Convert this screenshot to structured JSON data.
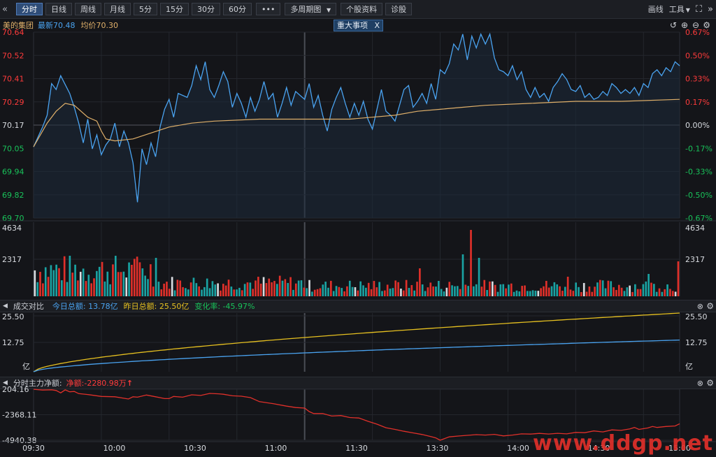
{
  "toolbar": {
    "collapse_icon": "double-chevron-left-icon",
    "tabs": [
      "分时",
      "日线",
      "周线",
      "月线",
      "5分",
      "15分",
      "30分",
      "60分"
    ],
    "more_label": "•••",
    "multi_period_label": "多周期图",
    "stock_info_label": "个股资料",
    "diagnose_label": "诊股",
    "draw_label": "画线",
    "tools_label": "工具",
    "expand_icon": "fullscreen-icon",
    "forward_icon": "double-chevron-right-icon"
  },
  "info": {
    "stock_name": "美的集团",
    "latest": "最新70.48",
    "avg": "均价70.30",
    "event_tag": "重大事项",
    "event_close": "X"
  },
  "colors": {
    "up": "#ff3b3b",
    "down": "#19c25a",
    "price_line": "#4aa3f0",
    "avg_line": "#e0b06a",
    "today_amount": "#4aa3f0",
    "yesterday_amount": "#e6c020"
  },
  "price_axis": {
    "left": [
      "70.64",
      "70.52",
      "70.41",
      "70.29",
      "70.17",
      "70.05",
      "69.94",
      "69.82",
      "69.70"
    ],
    "right": [
      "0.67%",
      "0.50%",
      "0.33%",
      "0.17%",
      "0.00%",
      "-0.17%",
      "-0.33%",
      "-0.50%",
      "-0.67%"
    ]
  },
  "volume_axis": {
    "top": "4634",
    "mid": "2317"
  },
  "turnover_panel": {
    "title": "成交对比",
    "today": "今日总额: 13.78亿",
    "yesterday": "昨日总额: 25.50亿",
    "change": "变化率: -45.97%",
    "axis": [
      "25.50",
      "12.75",
      "亿"
    ]
  },
  "netflow_panel": {
    "title": "分时主力净额:",
    "net": "净额:-2280.98万",
    "up_arrow": "↑",
    "axis": [
      "204.16",
      "-2368.11",
      "-4940.38"
    ]
  },
  "time_axis": [
    "09:30",
    "10:00",
    "10:30",
    "11:00",
    "11:30",
    "13:30",
    "14:00",
    "14:30",
    "15:00"
  ],
  "watermark": "www.ddgp.net",
  "chart_data": {
    "type": "line",
    "price_range": [
      69.7,
      70.64
    ],
    "prev_close": 70.17,
    "price_points": [
      [
        0,
        70.06
      ],
      [
        2,
        70.16
      ],
      [
        3,
        70.22
      ],
      [
        4,
        70.38
      ],
      [
        5,
        70.35
      ],
      [
        6,
        70.42
      ],
      [
        8,
        70.33
      ],
      [
        9,
        70.26
      ],
      [
        10,
        70.18
      ],
      [
        11,
        70.08
      ],
      [
        12,
        70.2
      ],
      [
        13,
        70.05
      ],
      [
        14,
        70.12
      ],
      [
        15,
        70.02
      ],
      [
        16,
        70.07
      ],
      [
        17,
        70.1
      ],
      [
        18,
        70.18
      ],
      [
        19,
        70.06
      ],
      [
        20,
        70.14
      ],
      [
        21,
        70.08
      ],
      [
        22,
        69.98
      ],
      [
        23,
        69.78
      ],
      [
        24,
        70.05
      ],
      [
        25,
        69.97
      ],
      [
        26,
        70.08
      ],
      [
        27,
        70.01
      ],
      [
        28,
        70.16
      ],
      [
        29,
        70.25
      ],
      [
        30,
        70.3
      ],
      [
        31,
        70.21
      ],
      [
        32,
        70.33
      ],
      [
        34,
        70.31
      ],
      [
        35,
        70.37
      ],
      [
        36,
        70.47
      ],
      [
        37,
        70.4
      ],
      [
        38,
        70.49
      ],
      [
        39,
        70.35
      ],
      [
        40,
        70.31
      ],
      [
        41,
        70.37
      ],
      [
        42,
        70.44
      ],
      [
        43,
        70.39
      ],
      [
        44,
        70.26
      ],
      [
        45,
        70.33
      ],
      [
        46,
        70.28
      ],
      [
        47,
        70.21
      ],
      [
        48,
        70.31
      ],
      [
        49,
        70.24
      ],
      [
        50,
        70.3
      ],
      [
        51,
        70.39
      ],
      [
        52,
        70.3
      ],
      [
        53,
        70.33
      ],
      [
        54,
        70.21
      ],
      [
        55,
        70.28
      ],
      [
        56,
        70.36
      ],
      [
        57,
        70.27
      ],
      [
        58,
        70.34
      ],
      [
        60,
        70.3
      ],
      [
        61,
        70.38
      ],
      [
        62,
        70.26
      ],
      [
        63,
        70.32
      ],
      [
        64,
        70.22
      ],
      [
        65,
        70.14
      ],
      [
        66,
        70.25
      ],
      [
        67,
        70.31
      ],
      [
        68,
        70.36
      ],
      [
        69,
        70.28
      ],
      [
        70,
        70.21
      ],
      [
        71,
        70.28
      ],
      [
        72,
        70.22
      ],
      [
        73,
        70.29
      ],
      [
        74,
        70.2
      ],
      [
        75,
        70.15
      ],
      [
        76,
        70.25
      ],
      [
        77,
        70.35
      ],
      [
        78,
        70.24
      ],
      [
        79,
        70.22
      ],
      [
        80,
        70.19
      ],
      [
        81,
        70.27
      ],
      [
        82,
        70.35
      ],
      [
        83,
        70.37
      ],
      [
        84,
        70.26
      ],
      [
        85,
        70.29
      ],
      [
        86,
        70.33
      ],
      [
        87,
        70.28
      ],
      [
        88,
        70.38
      ],
      [
        89,
        70.3
      ],
      [
        90,
        70.45
      ],
      [
        91,
        70.43
      ],
      [
        92,
        70.48
      ],
      [
        93,
        70.58
      ],
      [
        94,
        70.55
      ],
      [
        95,
        70.63
      ],
      [
        96,
        70.5
      ],
      [
        97,
        70.62
      ],
      [
        98,
        70.56
      ],
      [
        99,
        70.63
      ],
      [
        100,
        70.58
      ],
      [
        101,
        70.63
      ],
      [
        102,
        70.51
      ],
      [
        103,
        70.45
      ],
      [
        104,
        70.44
      ],
      [
        105,
        70.42
      ],
      [
        106,
        70.47
      ],
      [
        107,
        70.4
      ],
      [
        108,
        70.44
      ],
      [
        109,
        70.35
      ],
      [
        110,
        70.31
      ],
      [
        111,
        70.36
      ],
      [
        112,
        70.31
      ],
      [
        113,
        70.33
      ],
      [
        114,
        70.29
      ],
      [
        115,
        70.36
      ],
      [
        116,
        70.39
      ],
      [
        117,
        70.43
      ],
      [
        118,
        70.4
      ],
      [
        119,
        70.35
      ],
      [
        120,
        70.34
      ],
      [
        121,
        70.37
      ],
      [
        122,
        70.31
      ],
      [
        123,
        70.33
      ],
      [
        124,
        70.3
      ],
      [
        125,
        70.31
      ],
      [
        126,
        70.34
      ],
      [
        127,
        70.32
      ],
      [
        128,
        70.38
      ],
      [
        129,
        70.36
      ],
      [
        130,
        70.33
      ],
      [
        131,
        70.35
      ],
      [
        132,
        70.33
      ],
      [
        133,
        70.36
      ],
      [
        134,
        70.32
      ],
      [
        135,
        70.38
      ],
      [
        136,
        70.36
      ],
      [
        137,
        70.43
      ],
      [
        138,
        70.45
      ],
      [
        139,
        70.42
      ],
      [
        140,
        70.46
      ],
      [
        141,
        70.44
      ],
      [
        142,
        70.49
      ],
      [
        143,
        70.47
      ]
    ],
    "avg_points": [
      [
        0,
        70.06
      ],
      [
        3,
        70.18
      ],
      [
        5,
        70.24
      ],
      [
        7,
        70.28
      ],
      [
        9,
        70.27
      ],
      [
        12,
        70.21
      ],
      [
        14,
        70.19
      ],
      [
        15,
        70.14
      ],
      [
        16,
        70.1
      ],
      [
        18,
        70.09
      ],
      [
        22,
        70.1
      ],
      [
        26,
        70.13
      ],
      [
        30,
        70.16
      ],
      [
        35,
        70.18
      ],
      [
        40,
        70.19
      ],
      [
        50,
        70.2
      ],
      [
        60,
        70.2
      ],
      [
        70,
        70.2
      ],
      [
        75,
        70.21
      ],
      [
        80,
        70.22
      ],
      [
        85,
        70.24
      ],
      [
        90,
        70.25
      ],
      [
        95,
        70.26
      ],
      [
        100,
        70.27
      ],
      [
        110,
        70.28
      ],
      [
        120,
        70.29
      ],
      [
        130,
        70.29
      ],
      [
        143,
        70.3
      ]
    ],
    "volume_max": 4634,
    "turnover_range": [
      0,
      25.5
    ],
    "turnover_today_end": 13.78,
    "turnover_yesterday_end": 25.5,
    "netflow_range": [
      -4940.38,
      204.16
    ],
    "netflow_points": [
      [
        0,
        200
      ],
      [
        2,
        120
      ],
      [
        4,
        150
      ],
      [
        5,
        80
      ],
      [
        6,
        -160
      ],
      [
        7,
        140
      ],
      [
        8,
        -60
      ],
      [
        9,
        -20
      ],
      [
        10,
        -240
      ],
      [
        12,
        -330
      ],
      [
        15,
        -520
      ],
      [
        18,
        -560
      ],
      [
        21,
        -780
      ],
      [
        22,
        -560
      ],
      [
        23,
        -600
      ],
      [
        25,
        -380
      ],
      [
        27,
        -560
      ],
      [
        29,
        -740
      ],
      [
        30,
        -740
      ],
      [
        31,
        -520
      ],
      [
        33,
        -600
      ],
      [
        35,
        -360
      ],
      [
        37,
        -420
      ],
      [
        39,
        -220
      ],
      [
        41,
        -260
      ],
      [
        42,
        -300
      ],
      [
        44,
        -460
      ],
      [
        46,
        -500
      ],
      [
        48,
        -640
      ],
      [
        50,
        -1050
      ],
      [
        53,
        -1250
      ],
      [
        56,
        -1500
      ],
      [
        58,
        -1640
      ],
      [
        60,
        -1700
      ],
      [
        61,
        -2050
      ],
      [
        62,
        -2250
      ],
      [
        64,
        -2250
      ],
      [
        66,
        -2500
      ],
      [
        68,
        -2450
      ],
      [
        70,
        -2650
      ],
      [
        72,
        -2700
      ],
      [
        74,
        -3030
      ],
      [
        76,
        -3320
      ],
      [
        78,
        -3680
      ],
      [
        80,
        -3850
      ],
      [
        82,
        -4040
      ],
      [
        84,
        -4200
      ],
      [
        86,
        -4360
      ],
      [
        88,
        -4580
      ],
      [
        89,
        -4700
      ],
      [
        90,
        -4940
      ],
      [
        92,
        -4600
      ],
      [
        94,
        -4520
      ],
      [
        96,
        -4450
      ],
      [
        98,
        -4380
      ],
      [
        100,
        -4420
      ],
      [
        102,
        -4350
      ],
      [
        104,
        -4500
      ],
      [
        106,
        -4420
      ],
      [
        108,
        -4300
      ],
      [
        110,
        -4320
      ],
      [
        112,
        -4250
      ],
      [
        114,
        -4310
      ],
      [
        116,
        -4240
      ],
      [
        118,
        -4300
      ],
      [
        120,
        -4150
      ],
      [
        122,
        -4180
      ],
      [
        124,
        -4000
      ],
      [
        126,
        -4100
      ],
      [
        128,
        -3900
      ],
      [
        130,
        -3950
      ],
      [
        132,
        -3800
      ],
      [
        133,
        -3650
      ],
      [
        134,
        -3850
      ],
      [
        136,
        -3700
      ],
      [
        137,
        -3550
      ],
      [
        138,
        -3650
      ],
      [
        140,
        -3550
      ],
      [
        142,
        -3500
      ],
      [
        143,
        -3280
      ]
    ]
  }
}
